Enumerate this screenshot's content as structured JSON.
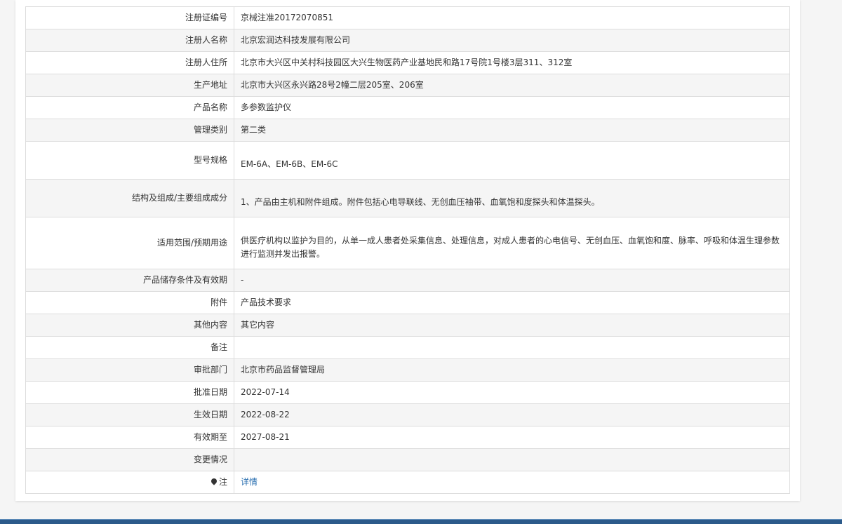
{
  "rows": [
    {
      "label": "注册证编号",
      "value": "京械注准20172070851"
    },
    {
      "label": "注册人名称",
      "value": "北京宏润达科技发展有限公司"
    },
    {
      "label": "注册人住所",
      "value": "北京市大兴区中关村科技园区大兴生物医药产业基地民和路17号院1号楼3层311、312室"
    },
    {
      "label": "生产地址",
      "value": "北京市大兴区永兴路28号2幢二层205室、206室"
    },
    {
      "label": "产品名称",
      "value": "多参数监护仪"
    },
    {
      "label": "管理类别",
      "value": "第二类"
    },
    {
      "label": "型号规格",
      "value": "EM-6A、EM-6B、EM-6C"
    },
    {
      "label": "结构及组成/主要组成成分",
      "value": "1、产品由主机和附件组成。附件包括心电导联线、无创血压袖带、血氧饱和度探头和体温探头。"
    },
    {
      "label": "适用范围/预期用途",
      "value": "供医疗机构以监护为目的，从单一成人患者处采集信息、处理信息，对成人患者的心电信号、无创血压、血氧饱和度、脉率、呼吸和体温生理参数进行监测并发出报警。"
    },
    {
      "label": "产品储存条件及有效期",
      "value": "-"
    },
    {
      "label": "附件",
      "value": "产品技术要求"
    },
    {
      "label": "其他内容",
      "value": "其它内容"
    },
    {
      "label": "备注",
      "value": ""
    },
    {
      "label": "审批部门",
      "value": "北京市药品监督管理局"
    },
    {
      "label": "批准日期",
      "value": "2022-07-14"
    },
    {
      "label": "生效日期",
      "value": "2022-08-22"
    },
    {
      "label": "有效期至",
      "value": "2027-08-21"
    },
    {
      "label": "变更情况",
      "value": ""
    }
  ],
  "note": {
    "icon": "pin-icon",
    "label": "注",
    "link_text": "详情"
  },
  "colors": {
    "border": "#dddddd",
    "alt_row": "#f5f5f5",
    "link": "#2a6fb0",
    "footer_bar": "#2c5a8a"
  }
}
